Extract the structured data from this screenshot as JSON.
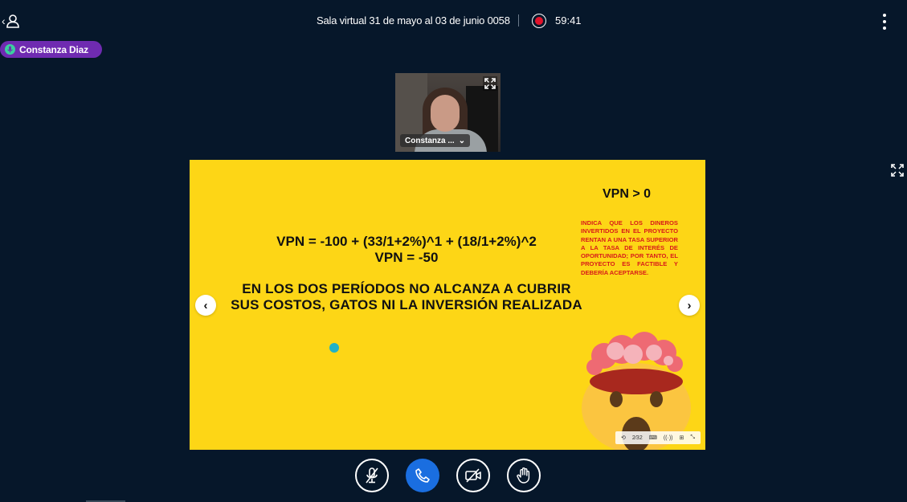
{
  "header": {
    "room_title": "Sala virtual 31 de mayo al 03 de junio 0058",
    "timer": "59:41",
    "record_icon": "record-icon",
    "options_icon": "kebab-menu-icon",
    "back_icon": "back-user-icon"
  },
  "speaker": {
    "name": "Constanza Diaz",
    "icon": "microphone-icon"
  },
  "webcam": {
    "label": "Constanza ...",
    "dropdown_icon": "chevron-down-icon",
    "expand_icon": "expand-icon"
  },
  "slide": {
    "formula_line1": "VPN = -100 + (33/1+2%)^1 + (18/1+2%)^2",
    "formula_line2": "VPN = -50",
    "statement": "EN LOS DOS PERÍODOS NO ALCANZA A CUBRIR SUS COSTOS, GATOS NI LA INVERSIÓN REALIZADA",
    "vpn_heading": "VPN > 0",
    "note": "INDICA QUE LOS DINEROS INVERTIDOS EN EL PROYECTO RENTAN A UNA TASA SUPERIOR A LA TASA DE INTERÉS DE OPORTUNIDAD; POR TANTO, EL PROYECTO ES FACTIBLE Y DEBERÍA ACEPTARSE.",
    "prev_label": "‹",
    "next_label": "›",
    "emoji_icon": "mind-blown-emoji",
    "toolbar": [
      "⟲",
      "2⁄32",
      "⌨",
      "((·))",
      "⊞",
      "⤡"
    ]
  },
  "controls": {
    "mute_icon": "microphone-muted-icon",
    "leave_icon": "phone-icon",
    "video_icon": "video-off-icon",
    "raise_hand_icon": "raise-hand-icon"
  },
  "colors": {
    "background": "#06172a",
    "slide_yellow": "#fdd616",
    "note_red": "#d81a1a",
    "speaker_purple": "#6f2bb1",
    "primary_blue": "#1a6ee0",
    "record_red": "#e1122a"
  }
}
